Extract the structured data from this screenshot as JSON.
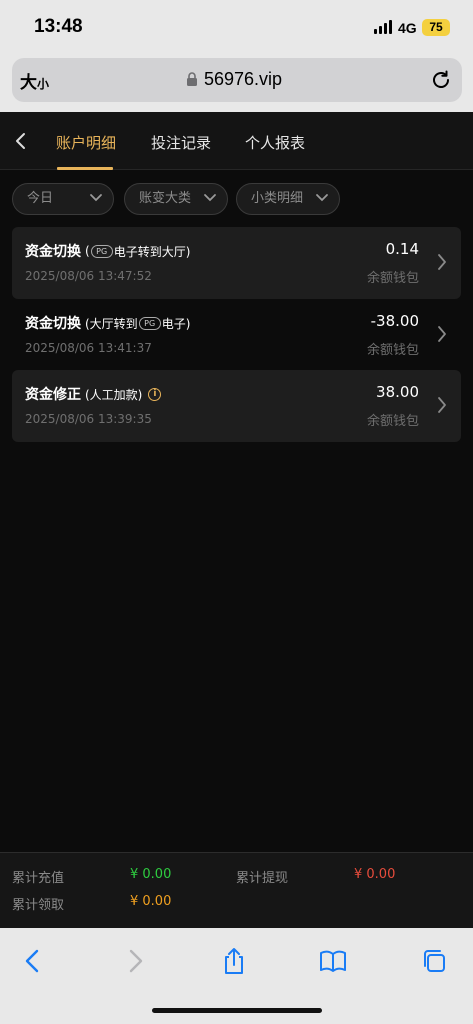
{
  "status": {
    "time": "13:48",
    "network": "4G",
    "battery": "75"
  },
  "browser": {
    "text_size_big": "大",
    "text_size_small": "小",
    "url": "56976.vip"
  },
  "tabs": [
    {
      "label": "账户明细",
      "active": true
    },
    {
      "label": "投注记录",
      "active": false
    },
    {
      "label": "个人报表",
      "active": false
    }
  ],
  "filters": [
    {
      "label": "今日"
    },
    {
      "label": "账变大类"
    },
    {
      "label": "小类明细"
    }
  ],
  "records": [
    {
      "title": "资金切换",
      "sub_open": "(",
      "sub_mid_before": "",
      "sub_after": "电子转到大厅)",
      "pg_position": "start",
      "time": "2025/08/06 13:47:52",
      "amount": "0.14",
      "wallet": "余额钱包"
    },
    {
      "title": "资金切换",
      "sub_open": "(大厅转到",
      "sub_after": "电子)",
      "pg_position": "middle",
      "time": "2025/08/06 13:41:37",
      "amount": "-38.00",
      "wallet": "余额钱包"
    },
    {
      "title": "资金修正",
      "sub_open": "(人工加款)",
      "sub_after": "",
      "pg_position": "none",
      "time": "2025/08/06 13:39:35",
      "amount": "38.00",
      "wallet": "余额钱包"
    }
  ],
  "pg_badge": "PG",
  "summary": {
    "deposit_label": "累计充值",
    "deposit_value": "¥ 0.00",
    "withdraw_label": "累计提现",
    "withdraw_value": "¥ 0.00",
    "claim_label": "累计领取",
    "claim_value": "¥ 0.00"
  },
  "colors": {
    "accent": "#e8b45a",
    "green": "#2ecc40",
    "red": "#e74c3c",
    "orange": "#f0a020"
  }
}
